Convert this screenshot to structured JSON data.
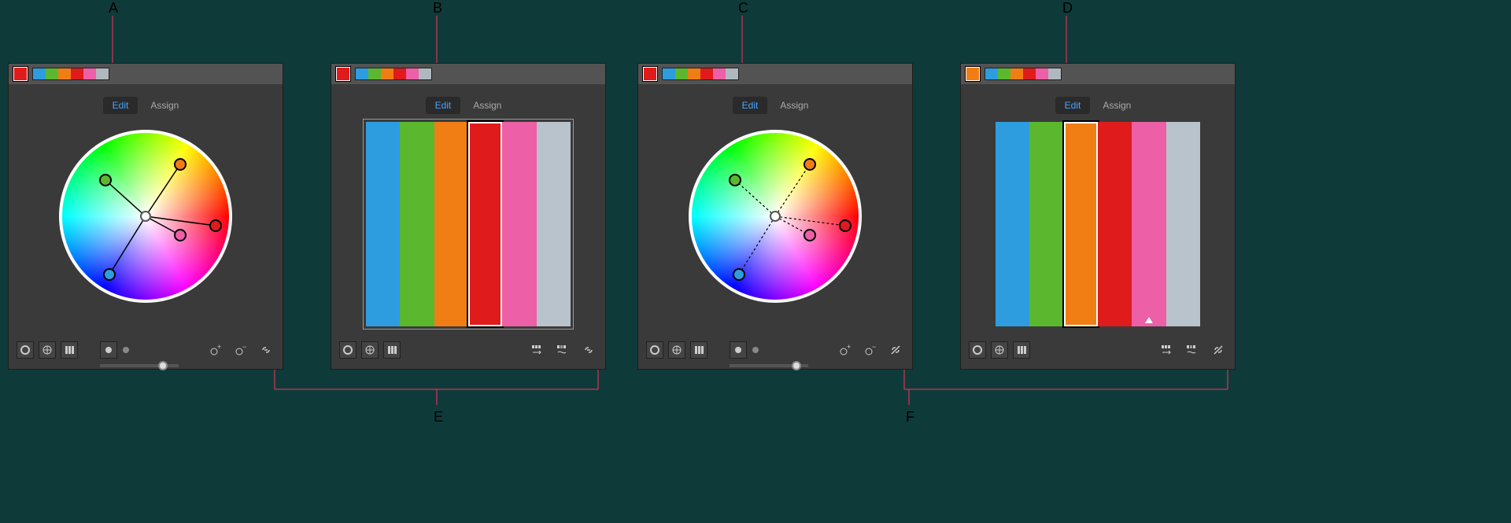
{
  "callouts": {
    "A": "A",
    "B": "B",
    "C": "C",
    "D": "D",
    "E": "E",
    "F": "F"
  },
  "tabs": {
    "edit": "Edit",
    "assign": "Assign"
  },
  "strip_colors": [
    "#2e9de0",
    "#5bb82e",
    "#f07e15",
    "#e01b1b",
    "#ed5fa6",
    "#b0b8bf"
  ],
  "panel1": {
    "current": "#e01b1b",
    "tool_icons": {
      "ring": "ring",
      "wheel": "wheel",
      "bars": "bars"
    },
    "mode_icons": {
      "a": "mode-a",
      "b": "mode-b"
    },
    "right_icons": {
      "add": "add-color",
      "remove": "remove-color",
      "link": "link-harmony"
    }
  },
  "panel2": {
    "current": "#e01b1b",
    "bars": [
      "#2e9de0",
      "#5bb82e",
      "#f07e15",
      "#e01b1b",
      "#ed5fa6",
      "#b8c3cc"
    ],
    "selected_index": 3,
    "right_icons": {
      "random1": "randomly-change-order",
      "random2": "randomly-change-sat-bright",
      "link": "link-harmony"
    }
  },
  "panel3": {
    "current": "#e01b1b",
    "right_icons": {
      "add": "add-color",
      "remove": "remove-color",
      "unlink": "unlink-harmony"
    }
  },
  "panel4": {
    "current": "#f07e15",
    "bars": [
      "#2e9de0",
      "#5bb82e",
      "#f07e15",
      "#e01b1b",
      "#ed5fa6",
      "#b8c3cc"
    ],
    "selected_index": 2,
    "right_icons": {
      "random1": "randomly-change-order",
      "random2": "randomly-change-sat-bright",
      "unlink": "unlink-harmony"
    }
  }
}
